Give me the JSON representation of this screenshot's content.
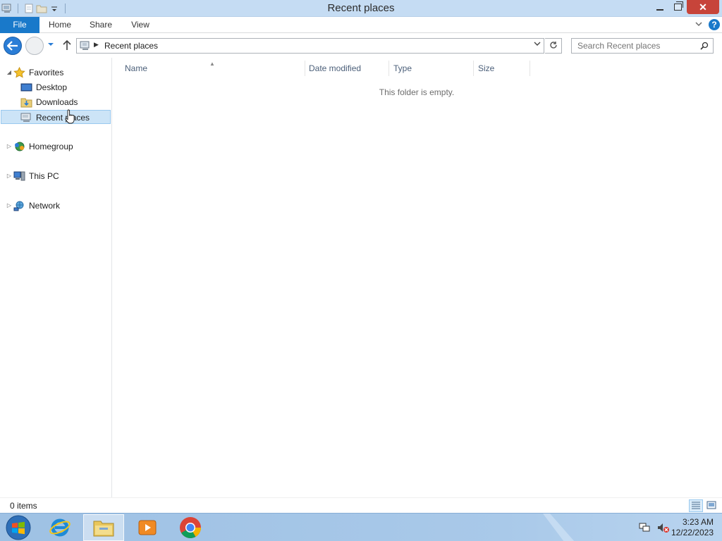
{
  "window": {
    "title": "Recent places"
  },
  "ribbon": {
    "tabs": [
      "File",
      "Home",
      "Share",
      "View"
    ]
  },
  "address": {
    "crumb": "Recent places"
  },
  "search": {
    "placeholder": "Search Recent places"
  },
  "navpane": {
    "favorites": "Favorites",
    "desktop": "Desktop",
    "downloads": "Downloads",
    "recent_places": "Recent places",
    "homegroup": "Homegroup",
    "this_pc": "This PC",
    "network": "Network"
  },
  "columns": [
    "Name",
    "Date modified",
    "Type",
    "Size"
  ],
  "content": {
    "empty_message": "This folder is empty."
  },
  "status": {
    "item_count": "0 items"
  },
  "clock": {
    "time": "3:23 AM",
    "date": "12/22/2023"
  },
  "colors": {
    "accent": "#1979ca",
    "selection": "#cce4f7",
    "titlebar": "#c5dcf3",
    "close": "#c7443a"
  },
  "icons": [
    "computer-icon",
    "star-icon",
    "desktop-icon",
    "downloads-icon",
    "recent-places-icon",
    "homegroup-icon",
    "this-pc-icon",
    "network-icon",
    "search-icon",
    "refresh-icon",
    "help-icon",
    "windows-start-icon",
    "internet-explorer-icon",
    "file-explorer-icon",
    "media-player-icon",
    "chrome-icon",
    "network-tray-icon",
    "volume-muted-icon"
  ]
}
